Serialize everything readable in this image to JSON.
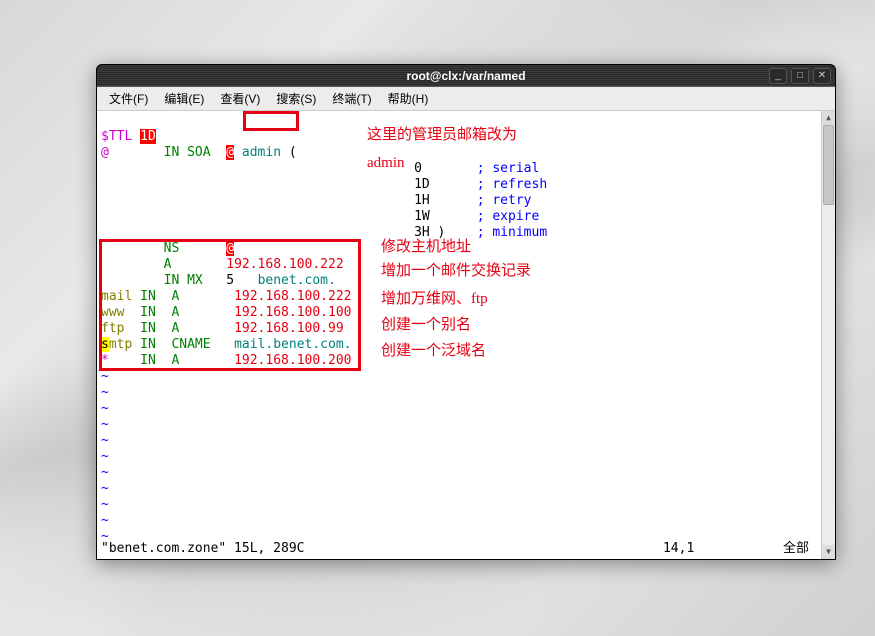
{
  "window": {
    "title": "root@clx:/var/named"
  },
  "menubar": {
    "items": [
      "文件(F)",
      "编辑(E)",
      "查看(V)",
      "搜索(S)",
      "终端(T)",
      "帮助(H)"
    ]
  },
  "file": {
    "ttl_keyword": "$TTL",
    "ttl_value": "1D",
    "origin": "@",
    "in_soa": "IN SOA",
    "soa_at": "@",
    "soa_admin": "admin",
    "soa_paren": " (",
    "soa_lines": [
      {
        "val": "0 ",
        "comment": "; serial"
      },
      {
        "val": "1D",
        "comment": "; refresh"
      },
      {
        "val": "1H",
        "comment": "; retry"
      },
      {
        "val": "1W",
        "comment": "; expire"
      },
      {
        "val": "3H )",
        "comment": "; minimum"
      }
    ],
    "ns_line": {
      "type": "NS",
      "val": "@"
    },
    "records": [
      {
        "host": "",
        "in": "",
        "type": "A",
        "pri": "",
        "val": "192.168.100.222"
      },
      {
        "host": "",
        "in": "IN",
        "type": "MX",
        "pri": "5",
        "val": "benet.com."
      },
      {
        "host": "mail",
        "in": "IN",
        "type": "A",
        "pri": "",
        "val": "192.168.100.222"
      },
      {
        "host": "www",
        "in": "IN",
        "type": "A",
        "pri": "",
        "val": "192.168.100.100"
      },
      {
        "host": "ftp",
        "in": "IN",
        "type": "A",
        "pri": "",
        "val": "192.168.100.99"
      },
      {
        "host": "smtp",
        "in": "IN",
        "type": "CNAME",
        "pri": "",
        "val": "mail.benet.com."
      },
      {
        "host": "*",
        "in": "IN",
        "type": "A",
        "pri": "",
        "val": "192.168.100.200"
      }
    ]
  },
  "annotations": {
    "a1": "这里的管理员邮箱改为",
    "a2": "admin",
    "a3": "修改主机地址",
    "a4": "增加一个邮件交换记录",
    "a5": "增加万维网、ftp",
    "a6": "创建一个别名",
    "a7": "创建一个泛域名"
  },
  "status": {
    "left": "\"benet.com.zone\" 15L, 289C",
    "pos": "14,1",
    "right": "全部"
  }
}
